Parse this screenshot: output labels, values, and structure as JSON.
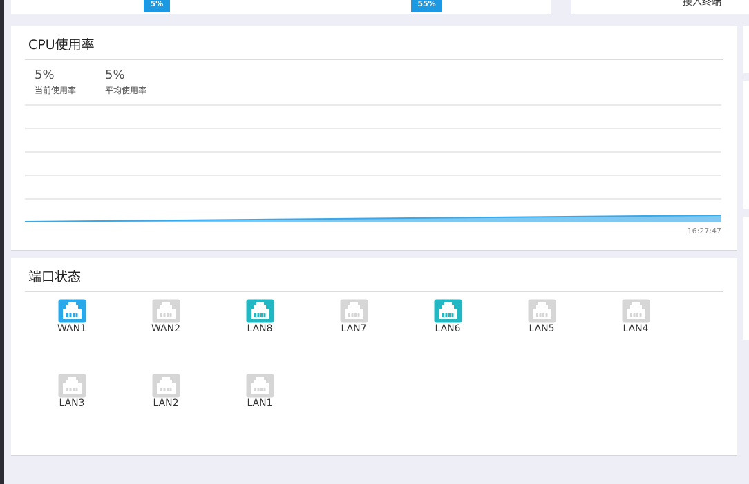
{
  "top_row": {
    "badge_1": "5%",
    "badge_2": "55%",
    "right_card_text": "接入终端"
  },
  "cpu": {
    "title": "CPU使用率",
    "current_value": "5%",
    "current_label": "当前使用率",
    "average_value": "5%",
    "average_label": "平均使用率",
    "time_label": "16:27:47"
  },
  "ports": {
    "title": "端口状态",
    "items": [
      {
        "label": "WAN1",
        "status": "active-blue"
      },
      {
        "label": "WAN2",
        "status": "inactive"
      },
      {
        "label": "LAN8",
        "status": "active-teal"
      },
      {
        "label": "LAN7",
        "status": "inactive"
      },
      {
        "label": "LAN6",
        "status": "active-teal"
      },
      {
        "label": "LAN5",
        "status": "inactive"
      },
      {
        "label": "LAN4",
        "status": "inactive"
      },
      {
        "label": "LAN3",
        "status": "inactive"
      },
      {
        "label": "LAN2",
        "status": "inactive"
      },
      {
        "label": "LAN1",
        "status": "inactive"
      }
    ]
  },
  "colors": {
    "accent": "#1b9ae3",
    "port_blue": "#29a9ea",
    "port_teal": "#22b8c3",
    "port_inactive": "#d6d6d6",
    "chart_line": "#3aa7e8"
  }
}
